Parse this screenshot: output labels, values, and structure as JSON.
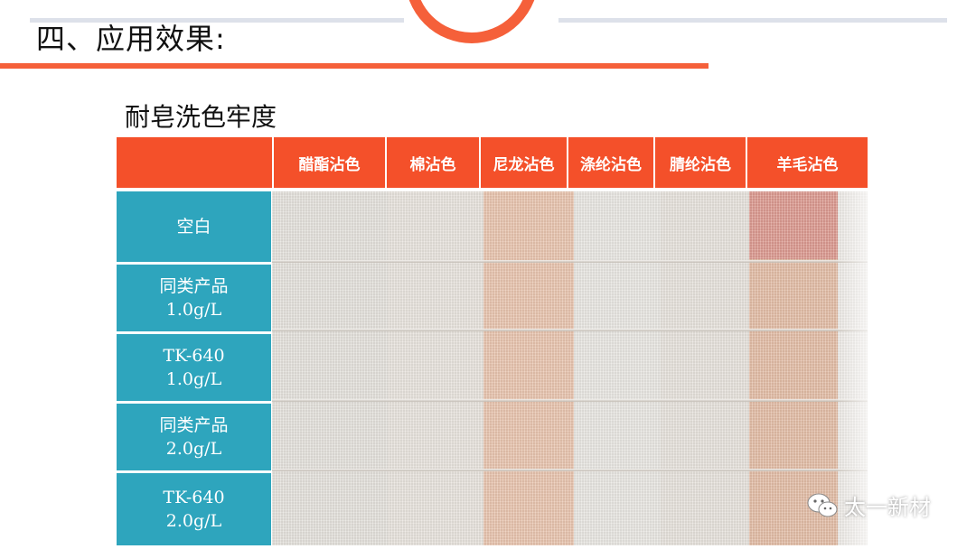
{
  "title": "四、应用效果:",
  "subtitle": "耐皂洗色牢度",
  "columns": [
    "醋酯沾色",
    "棉沾色",
    "尼龙沾色",
    "涤纶沾色",
    "腈纶沾色",
    "羊毛沾色"
  ],
  "rows": [
    {
      "line1": "空白",
      "line2": ""
    },
    {
      "line1": "同类产品",
      "line2": "1.0g/L"
    },
    {
      "line1": "TK-640",
      "line2": "1.0g/L"
    },
    {
      "line1": "同类产品",
      "line2": "2.0g/L"
    },
    {
      "line1": "TK-640",
      "line2": "2.0g/L"
    }
  ],
  "watermark": "太一新材",
  "colors": {
    "accent": "#f5603a",
    "header": "#f4502a",
    "row_label": "#2ea5bd",
    "nylon_stain": "#e8b59a",
    "wool_stain_blank": "#d98a80",
    "wool_stain": "#e2ab93"
  }
}
